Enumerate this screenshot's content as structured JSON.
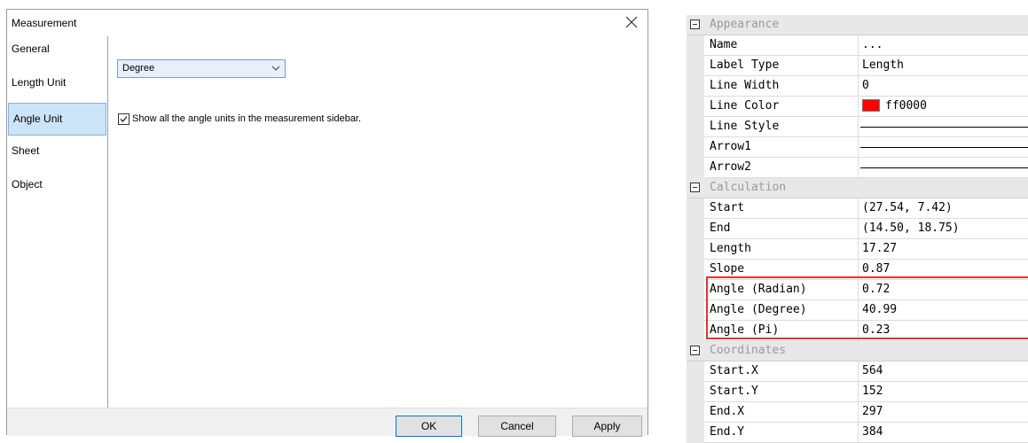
{
  "dialog": {
    "title": "Measurement",
    "nav": [
      "General",
      "Length Unit",
      "Angle Unit",
      "Sheet",
      "Object"
    ],
    "active_nav_index": 2,
    "angle_unit_select": {
      "value": "Degree"
    },
    "show_all_checkbox": {
      "checked": true,
      "label": "Show all the angle units in the measurement sidebar."
    },
    "buttons": {
      "ok": "OK",
      "cancel": "Cancel",
      "apply": "Apply"
    }
  },
  "property_grid": {
    "appearance": {
      "title": "Appearance",
      "rows": [
        {
          "name": "Name",
          "value": "..."
        },
        {
          "name": "Label Type",
          "value": "Length"
        },
        {
          "name": "Line Width",
          "value": "0"
        },
        {
          "name": "Line Color",
          "value": "ff0000",
          "color": "#ff0000"
        },
        {
          "name": "Line Style",
          "value": ""
        },
        {
          "name": "Arrow1",
          "value": ""
        },
        {
          "name": "Arrow2",
          "value": ""
        }
      ]
    },
    "calculation": {
      "title": "Calculation",
      "rows": [
        {
          "name": "Start",
          "value": "(27.54, 7.42)"
        },
        {
          "name": "End",
          "value": "(14.50, 18.75)"
        },
        {
          "name": "Length",
          "value": "17.27"
        },
        {
          "name": "Slope",
          "value": "0.87"
        },
        {
          "name": "Angle (Radian)",
          "value": "0.72"
        },
        {
          "name": "Angle (Degree)",
          "value": "40.99"
        },
        {
          "name": "Angle (Pi)",
          "value": "0.23"
        }
      ]
    },
    "coordinates": {
      "title": "Coordinates",
      "rows": [
        {
          "name": "Start.X",
          "value": "564"
        },
        {
          "name": "Start.Y",
          "value": "152"
        },
        {
          "name": "End.X",
          "value": "297"
        },
        {
          "name": "End.Y",
          "value": "384"
        }
      ]
    },
    "highlight_color": "#e63232"
  }
}
